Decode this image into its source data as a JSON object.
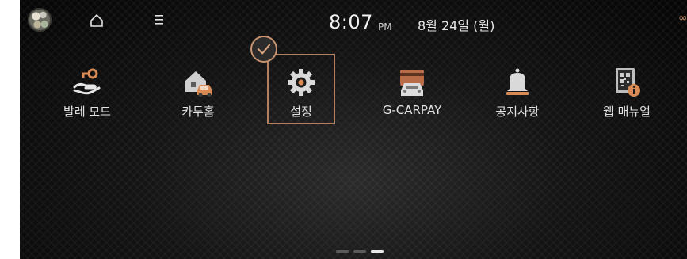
{
  "status_bar": {
    "time": "8:07",
    "ampm": "PM",
    "date": "8월 24일 (월)",
    "icons": [
      "profile-avatar",
      "home-icon",
      "menu-icon",
      "link-icon"
    ]
  },
  "apps": [
    {
      "label": "발레 모드",
      "icon": "valet-key-icon"
    },
    {
      "label": "카투홈",
      "icon": "car-to-home-icon"
    },
    {
      "label": "설정",
      "icon": "gear-icon",
      "selected": true
    },
    {
      "label": "G-CARPAY",
      "icon": "carpay-icon"
    },
    {
      "label": "공지사항",
      "icon": "bell-icon"
    },
    {
      "label": "웹 매뉴얼",
      "icon": "web-manual-icon"
    }
  ],
  "page_indicator": {
    "pages": 3,
    "current": 3
  },
  "colors": {
    "accent": "#b57f5f",
    "background": "#141414",
    "text": "#e9e9e9"
  }
}
